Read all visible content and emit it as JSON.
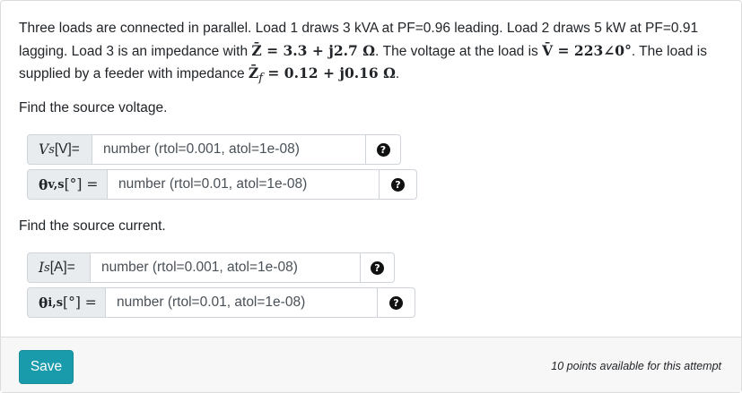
{
  "problem": {
    "t1": "Three loads are connected in parallel. Load 1 draws 3 kVA at PF=0.96 leading. Load 2 draws 5 kW at PF=0.91 lagging. Load 3 is an impedance with ",
    "z_sym": "Z̄",
    "z_val": " = 3.3 + j2.7 Ω",
    "t2": ". The voltage at the load is ",
    "v_sym": "V̄",
    "v_val": " = 223∠0°",
    "t3": ". The load is supplied by a feeder with impedance ",
    "zf_sym": "Z̄",
    "zf_sub": "f",
    "zf_val": " = 0.12 + j0.16 Ω",
    "t4": "."
  },
  "part1": {
    "prompt": "Find the source voltage.",
    "vs": {
      "sym": "V",
      "sub": "s",
      "rest": "[V]=",
      "placeholder": "number (rtol=0.001, atol=1e-08)"
    },
    "theta": {
      "sym": "θ",
      "sub": "v,s",
      "rest": " [°] =",
      "placeholder": "number (rtol=0.01, atol=1e-08)"
    }
  },
  "part2": {
    "prompt": "Find the source current.",
    "is": {
      "sym": "I",
      "sub": "s",
      "rest": "[A]=",
      "placeholder": "number (rtol=0.001, atol=1e-08)"
    },
    "theta": {
      "sym": "θ",
      "sub": "i,s",
      "rest": " [°] =",
      "placeholder": "number (rtol=0.01, atol=1e-08)"
    }
  },
  "help_glyph": "?",
  "footer": {
    "save_label": "Save",
    "points_text": "10 points available for this attempt"
  }
}
